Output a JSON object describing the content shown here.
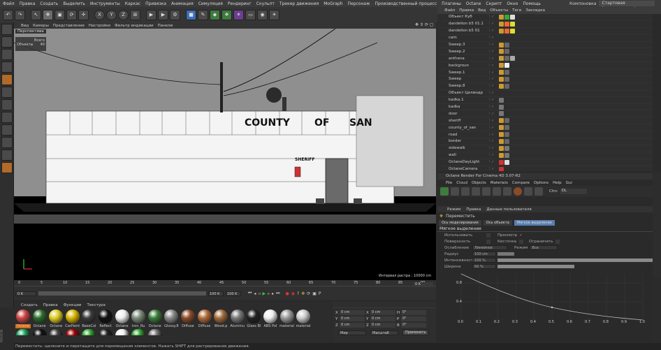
{
  "menu": [
    "Файл",
    "Правка",
    "Создать",
    "Выделить",
    "Инструменты",
    "Каркас",
    "Привязка",
    "Анимация",
    "Симуляция",
    "Рендеринг",
    "Скульпт",
    "Трекер движения",
    "MoGraph",
    "Персонаж",
    "Производственный процесс",
    "Плагины",
    "Octane",
    "Скрипт",
    "Окно",
    "Помощь"
  ],
  "layout_label": "Компоновка",
  "layout_value": "Стартовая (пользователь)",
  "viewport_menu": [
    "Вид",
    "Камеры",
    "Представление",
    "Настройки",
    "Фильтр индикации",
    "Панели"
  ],
  "viewport_title": "Перспектива",
  "stats": {
    "total": "Всего",
    "objects_label": "Объекты",
    "objects_value": "40"
  },
  "grid_spacing": "Интервал растра : 10000 cm",
  "scene_text": {
    "county": "COUNTY",
    "of": "OF",
    "san": "SAN",
    "sheriff": "SHERIFF"
  },
  "object_menu": [
    "Файл",
    "Правка",
    "Вид",
    "Объекты",
    "Теги",
    "Закладка"
  ],
  "objects": [
    "Объект Куб",
    "dandelion b5 01.1",
    "dandelion b5 01",
    "cam",
    "Sweep.3",
    "Sweep.2",
    "anthena",
    "backgroun",
    "Sweep.1",
    "Sweep",
    "Sweep.8",
    "Объект Цилиндр",
    "kadka.1",
    "kadka",
    "door",
    "sheriff",
    "county_of_san",
    "road",
    "border",
    "sidewalk",
    "wall",
    "OctaneDayLight",
    "OctaneCamera"
  ],
  "octane": {
    "title": "Octane Render For Cinema 4D 3.07-R2",
    "menu": [
      "File",
      "Cloud",
      "Objects",
      "Materials",
      "Compare",
      "Options",
      "Help",
      "Gui"
    ],
    "channel_label": "Chn:",
    "channel_value": "DL"
  },
  "attr": {
    "modes": [
      "Режим",
      "Правка",
      "Данные пользователя"
    ],
    "tool": "Переместить",
    "tabs": [
      "Ось моделирования",
      "Ось объекта",
      "Мягкое выделение"
    ],
    "section": "Мягкое выделение",
    "use": "Использовать",
    "preview": "Просмотр",
    "surface": "Поверхность",
    "brush": "Кисточка",
    "limit": "Ограничить",
    "falloff": "Ослабление",
    "falloff_value": "Линейное",
    "mode": "Режим",
    "mode_value": "Все",
    "radius": "Радиус",
    "radius_value": "100 cm",
    "strength": "Интенсивность",
    "strength_value": "100 %",
    "width": "Ширина",
    "width_value": "50 %"
  },
  "graph_y": [
    "0.8",
    "0.4"
  ],
  "graph_x": [
    "0.0",
    "0.1",
    "0.2",
    "0.3",
    "0.4",
    "0.5",
    "0.6",
    "0.7",
    "0.8",
    "0.9",
    "1.0"
  ],
  "timeline": {
    "ticks": [
      "0",
      "5",
      "10",
      "15",
      "20",
      "25",
      "30",
      "35",
      "40",
      "45",
      "50",
      "55",
      "60",
      "65",
      "70",
      "75",
      "80",
      "85",
      "90"
    ],
    "start": "0 K",
    "end": "0 K",
    "current": "0 K",
    "field1": "100 K",
    "field2": "100 K"
  },
  "material_menu": [
    "Создать",
    "Правка",
    "Функции",
    "Текстура"
  ],
  "materials_row1": [
    "Octane",
    "Octane",
    "Octane",
    "CarPaint",
    "BaseCol",
    "Reflect",
    "Octane",
    "Iron_Ru",
    "Octane",
    "Glossy.8",
    "Diffuse",
    "Diffuse",
    "Wood.p",
    "Aluminu",
    "Glass Bl",
    "ABS Pol",
    "material",
    "material"
  ],
  "materials_row2": [
    "",
    "",
    "",
    "",
    "",
    "",
    "",
    "",
    ""
  ],
  "coords": {
    "x": "X",
    "y": "Y",
    "z": "Z",
    "h": "H",
    "p": "P",
    "b": "B",
    "zero": "0 cm",
    "zero_deg": "0°",
    "world": "Мир",
    "size": "Масштаб",
    "apply": "Применить"
  },
  "status": "Переместить: щелкните и перетащите для перемещения элементов. Нажать SHIFT для растрирования движения."
}
